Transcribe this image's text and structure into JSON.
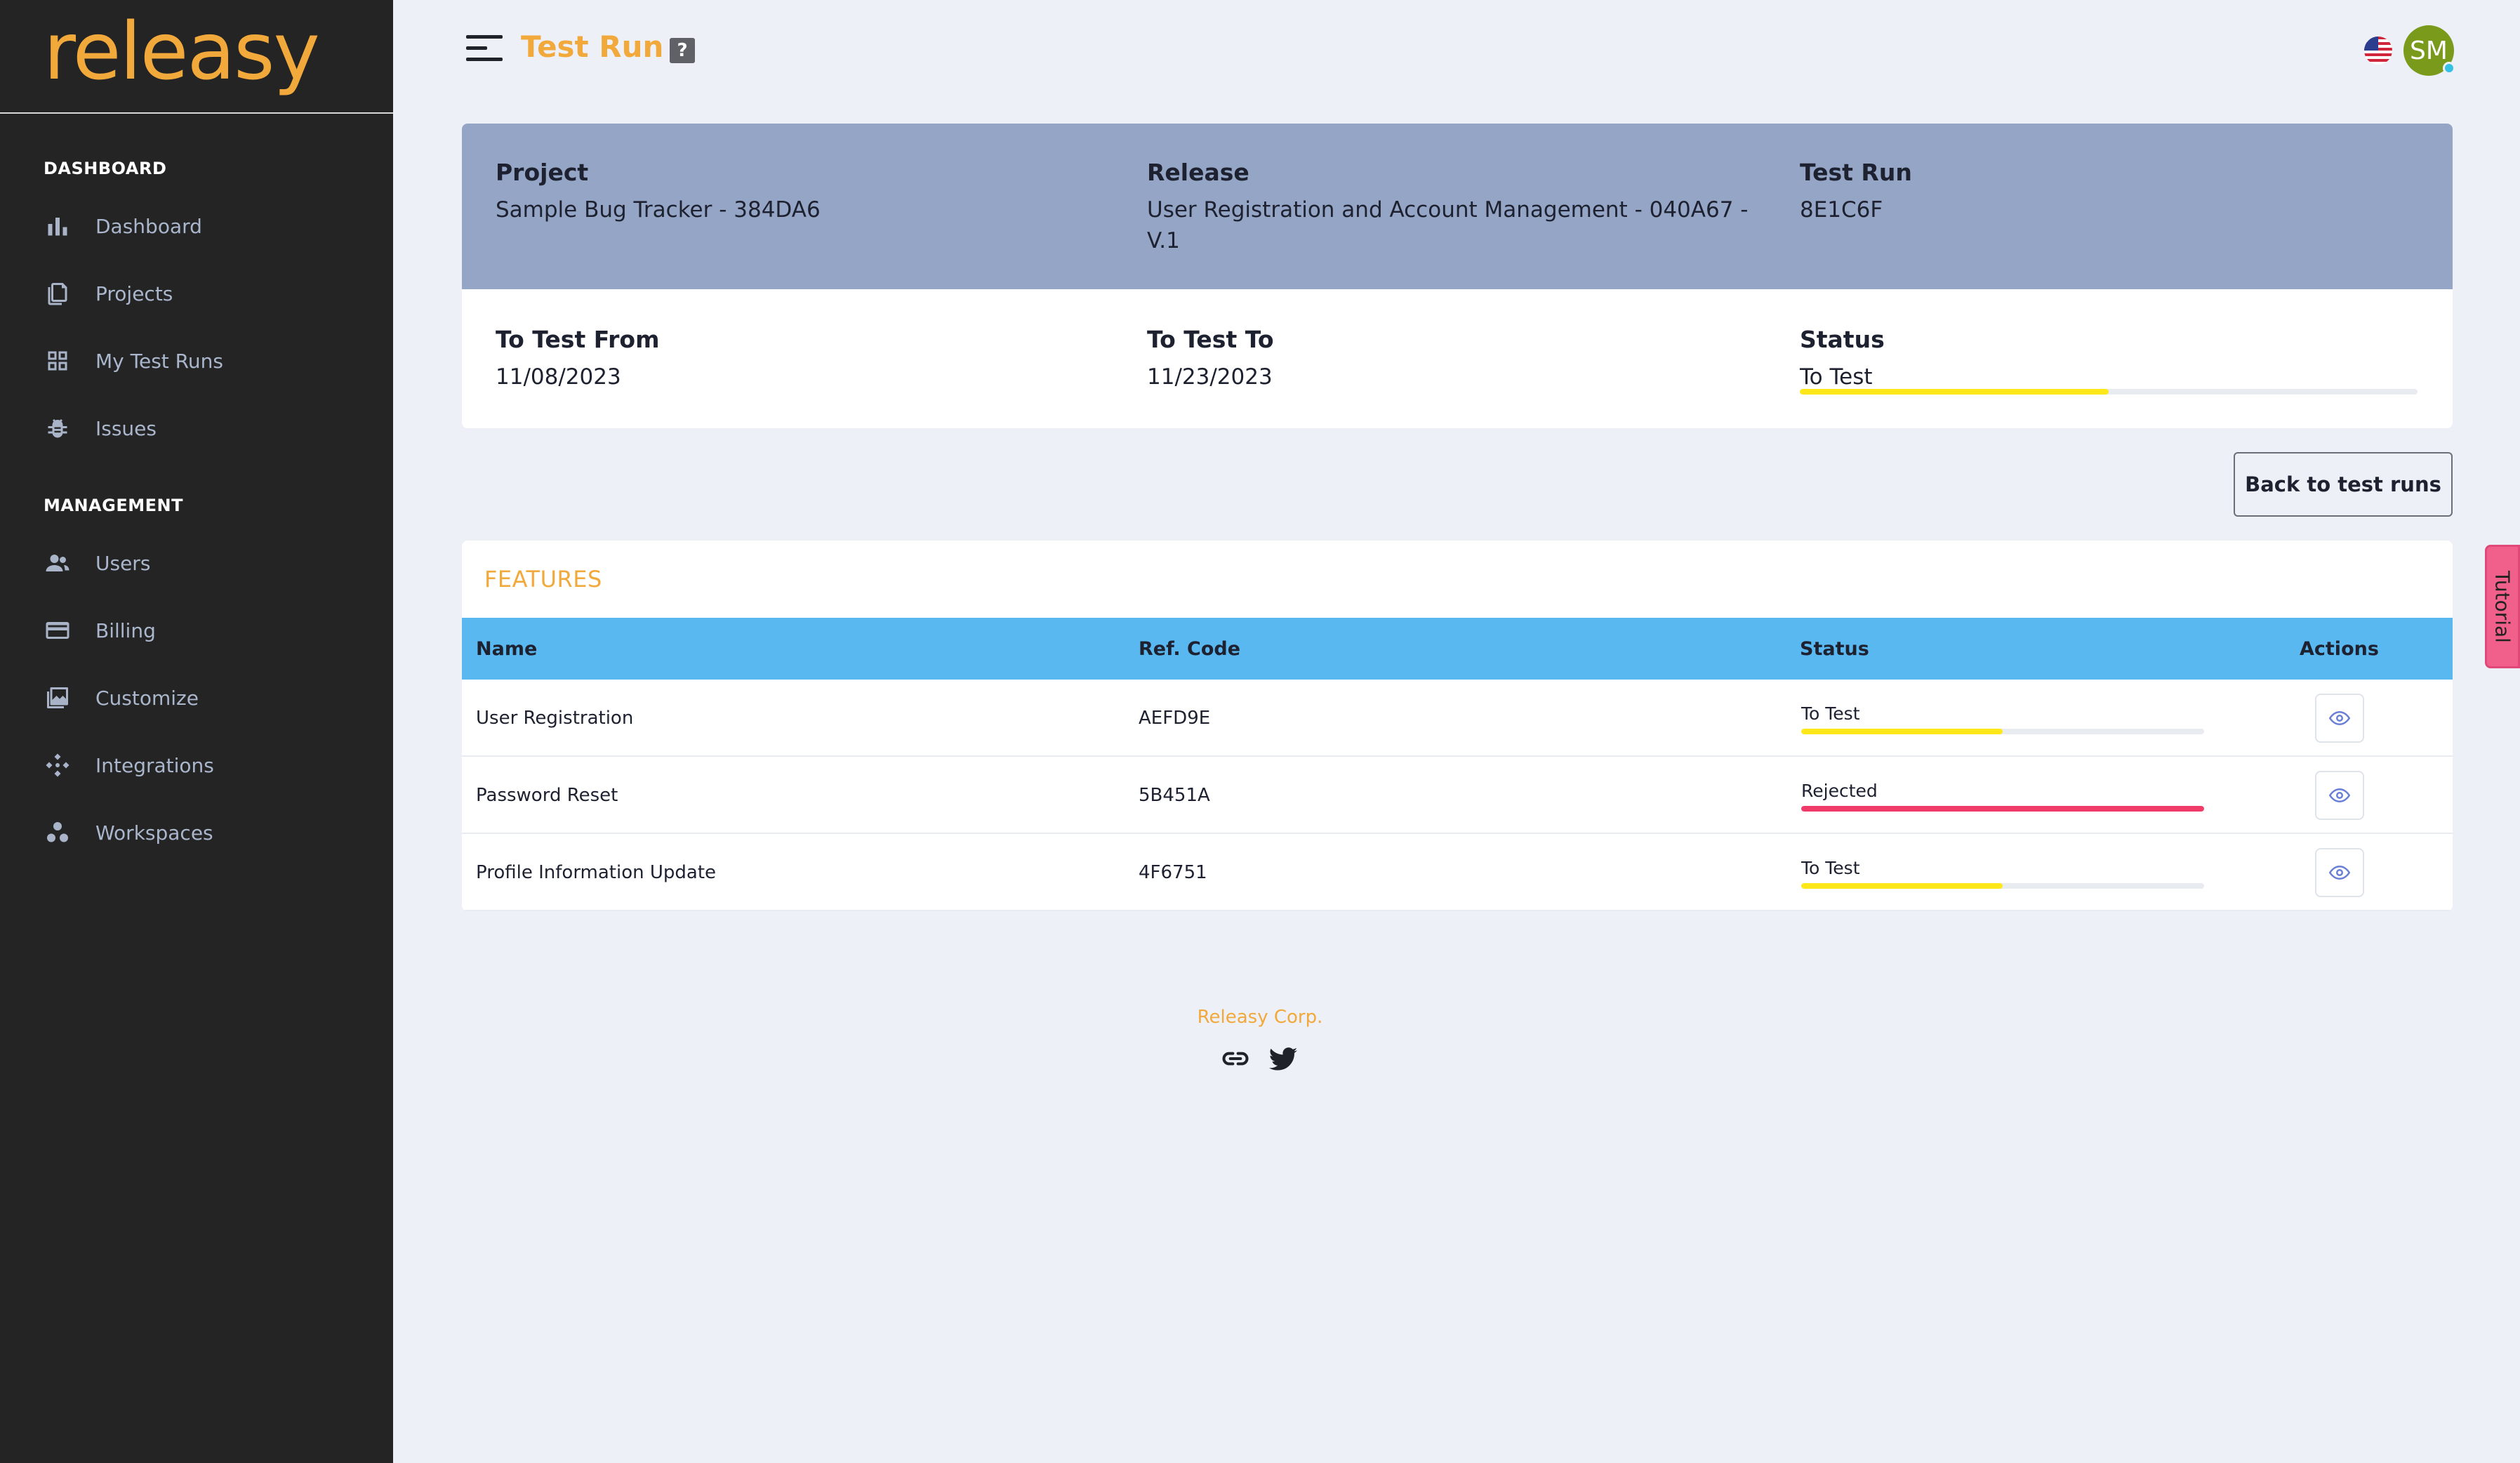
{
  "brand": {
    "logo": "releasy",
    "accent": "#f2a93b"
  },
  "sidebar": {
    "sections": [
      {
        "title": "DASHBOARD"
      },
      {
        "title": "MANAGEMENT"
      }
    ],
    "items": [
      {
        "label": "Dashboard",
        "icon": "bar-chart-icon"
      },
      {
        "label": "Projects",
        "icon": "documents-icon"
      },
      {
        "label": "My Test Runs",
        "icon": "grid-icon"
      },
      {
        "label": "Issues",
        "icon": "bug-icon"
      },
      {
        "label": "Users",
        "icon": "users-icon"
      },
      {
        "label": "Billing",
        "icon": "credit-card-icon"
      },
      {
        "label": "Customize",
        "icon": "image-gallery-icon"
      },
      {
        "label": "Integrations",
        "icon": "integrations-icon"
      },
      {
        "label": "Workspaces",
        "icon": "workspaces-icon"
      }
    ]
  },
  "header": {
    "title": "Test Run",
    "help": "?",
    "avatar_initials": "SM",
    "language_flag": "us-flag-icon"
  },
  "info": {
    "project_label": "Project",
    "project_value": "Sample Bug Tracker - 384DA6",
    "release_label": "Release",
    "release_value": "User Registration and Account Management - 040A67 - V.1",
    "testrun_label": "Test Run",
    "testrun_value": "8E1C6F",
    "from_label": "To Test From",
    "from_value": "11/08/2023",
    "to_label": "To Test To",
    "to_value": "11/23/2023",
    "status_label": "Status",
    "status_value": "To Test",
    "status_progress": 0.5,
    "status_color": "#ffe81a"
  },
  "actions": {
    "back_label": "Back to test runs"
  },
  "tutorial": {
    "label": "Tutorial"
  },
  "features": {
    "title": "FEATURES",
    "columns": [
      "Name",
      "Ref. Code",
      "Status",
      "Actions"
    ],
    "rows": [
      {
        "name": "User Registration",
        "ref": "AEFD9E",
        "status": "To Test",
        "progress": 0.5,
        "color": "#ffe81a"
      },
      {
        "name": "Password Reset",
        "ref": "5B451A",
        "status": "Rejected",
        "progress": 1.0,
        "color": "#f03a6a"
      },
      {
        "name": "Profile Information Update",
        "ref": "4F6751",
        "status": "To Test",
        "progress": 0.5,
        "color": "#ffe81a"
      }
    ]
  },
  "footer": {
    "company": "Releasy Corp.",
    "icons": [
      "link-icon",
      "twitter-icon"
    ]
  }
}
